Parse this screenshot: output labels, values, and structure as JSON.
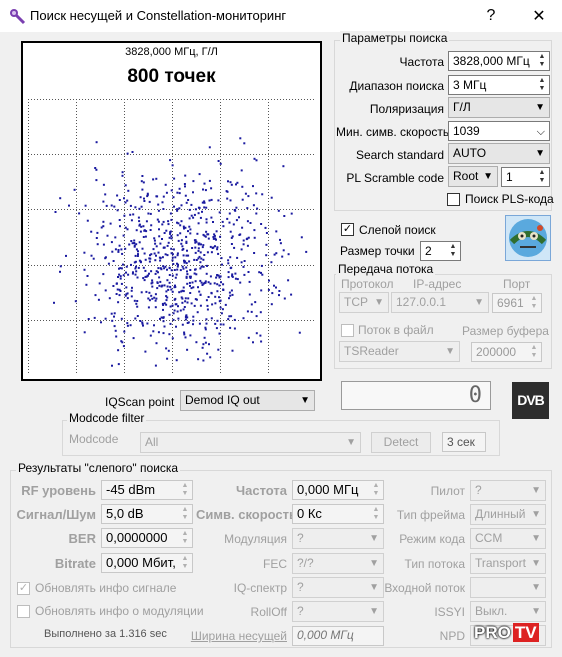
{
  "window": {
    "title": "Поиск несущей и Constellation-мониторинг",
    "help_btn": "?",
    "close_btn": "✕"
  },
  "plot": {
    "freq_label": "3828,000 МГц, Г/Л",
    "count_label": "800 точек",
    "point_color": "#1a1aa0"
  },
  "search_params": {
    "title": "Параметры поиска",
    "frequency": {
      "label": "Частота",
      "value": "3828,000 МГц"
    },
    "range": {
      "label": "Диапазон поиска",
      "value": "3 МГц"
    },
    "polarization": {
      "label": "Поляризация",
      "value": "Г/Л"
    },
    "min_symbol_rate": {
      "label": "Мин. симв. скорость",
      "value": "1039"
    },
    "search_standard": {
      "label": "Search standard",
      "value": "AUTO"
    },
    "pl_scramble": {
      "label": "PL Scramble code",
      "value": "Root",
      "num": "1"
    },
    "pls_search": {
      "label": "Поиск PLS-кода",
      "checked": false
    }
  },
  "blind_search": {
    "label": "Слепой поиск",
    "checked": true
  },
  "point_size": {
    "label": "Размер точки",
    "value": "2"
  },
  "stream": {
    "title": "Передача потока",
    "protocol_label": "Протокол",
    "ip_label": "IP-адрес",
    "port_label": "Порт",
    "protocol": "TCP",
    "ip": "127.0.0.1",
    "port": "6961",
    "to_file_label": "Поток в файл",
    "to_file_checked": false,
    "buffer_label": "Размер буфера",
    "reader": "TSReader",
    "buffer": "200000"
  },
  "counter": {
    "value": "0"
  },
  "dvb_logo": "DVB",
  "iqscan": {
    "label": "IQScan point",
    "value": "Demod IQ out"
  },
  "modcode": {
    "title": "Modcode filter",
    "label": "Modcode",
    "value": "All",
    "detect": "Detect",
    "timeout": "3 сек"
  },
  "results": {
    "title": "Результаты \"слепого\" поиска",
    "rf_level": {
      "label": "RF уровень",
      "value": "-45 dBm"
    },
    "snr": {
      "label": "Сигнал/Шум",
      "value": "5,0 dB"
    },
    "ber": {
      "label": "BER",
      "value": "0,0000000"
    },
    "bitrate": {
      "label": "Bitrate",
      "value": "0,000 Мбит,"
    },
    "update_signal": {
      "label": "Обновлять инфо сигнале",
      "checked": true
    },
    "update_mod": {
      "label": "Обновлять инфо о модуляции",
      "checked": false
    },
    "elapsed": "Выполнено за 1.316 sec",
    "frequency": {
      "label": "Частота",
      "value": "0,000 МГц"
    },
    "symbol_rate": {
      "label": "Симв. скорость",
      "value": "0 Кс"
    },
    "modulation": {
      "label": "Модуляция",
      "value": "?"
    },
    "fec": {
      "label": "FEC",
      "value": "?/?"
    },
    "iq_spectrum": {
      "label": "IQ-спектр",
      "value": "?"
    },
    "rolloff": {
      "label": "RollOff",
      "value": "?"
    },
    "carrier_width": {
      "label": "Ширина несущей",
      "value": "0,000 МГц"
    },
    "pilot": {
      "label": "Пилот",
      "value": "?"
    },
    "frame_type": {
      "label": "Тип фрейма",
      "value": "Длинный"
    },
    "code_mode": {
      "label": "Режим кода",
      "value": "CCM"
    },
    "stream_type": {
      "label": "Тип потока",
      "value": "Transport"
    },
    "input_stream": {
      "label": "Входной поток",
      "value": ""
    },
    "issyi": {
      "label": "ISSYI",
      "value": "Выкл."
    },
    "npd": {
      "label": "NPD",
      "value": ""
    }
  },
  "watermark": {
    "pro": "PRO",
    "tv": "TV"
  }
}
